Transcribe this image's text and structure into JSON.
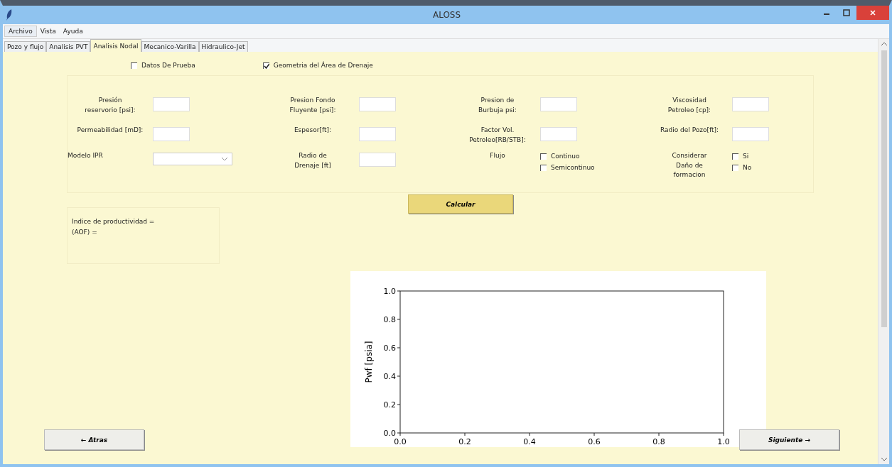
{
  "window": {
    "title": "ALOSS"
  },
  "menu": [
    {
      "label": "Archivo",
      "selected": true
    },
    {
      "label": "Vista",
      "selected": false
    },
    {
      "label": "Ayuda",
      "selected": false
    }
  ],
  "tabs": [
    {
      "label": "Pozo y flujo",
      "selected": false
    },
    {
      "label": "Analisis PVT",
      "selected": false
    },
    {
      "label": "Analisis Nodal",
      "selected": true
    },
    {
      "label": "Mecanico-Varilla",
      "selected": false
    },
    {
      "label": "Hidraulico-Jet",
      "selected": false
    }
  ],
  "options": [
    {
      "label": "Datos De Prueba",
      "checked": false
    },
    {
      "label": "Geometria del Área de Drenaje",
      "checked": true
    }
  ],
  "form": [
    {
      "kind": "input",
      "label": "Presión\nreservorio [psi]:"
    },
    {
      "kind": "input",
      "label": "Presion Fondo\nFluyente [psi]:"
    },
    {
      "kind": "input",
      "label": "Presion de\nBurbuja psi:"
    },
    {
      "kind": "input",
      "label": "Viscosidad\nPetroleo [cp]:"
    },
    {
      "kind": "input",
      "label": "Permeabilidad [mD]:"
    },
    {
      "kind": "input",
      "label": "Espesor[ft]:"
    },
    {
      "kind": "input",
      "label": "Factor Vol.\nPetroleo[RB/STB]:"
    },
    {
      "kind": "input",
      "label": "Radio del Pozo[ft]:"
    },
    {
      "kind": "select",
      "label": "Modelo IPR"
    },
    {
      "kind": "input",
      "label": "Radio de\nDrenaje [ft]"
    },
    {
      "kind": "checks",
      "label": "Flujo",
      "checks": [
        {
          "label": "Continuo",
          "checked": false
        },
        {
          "label": "Semicontinuo",
          "checked": false
        }
      ]
    },
    {
      "kind": "checks",
      "label": "Considerar\nDaño de\nformacion",
      "checks": [
        {
          "label": "Si",
          "checked": false
        },
        {
          "label": "No",
          "checked": false
        }
      ]
    }
  ],
  "calculate_button": "Calcular",
  "results": [
    "Indice de productividad =",
    "(AOF) ="
  ],
  "chart": {
    "chart_data": {
      "type": "line",
      "ylabel": "Pwf [psia]",
      "xlim": [
        0,
        1
      ],
      "ylim": [
        0,
        1
      ],
      "xticks": [
        {
          "value": 0,
          "label": "0.0"
        },
        {
          "value": 0.2,
          "label": "0.2"
        },
        {
          "value": 0.4,
          "label": "0.4"
        },
        {
          "value": 0.6,
          "label": "0.6"
        },
        {
          "value": 0.8,
          "label": "0.8"
        },
        {
          "value": 1,
          "label": "1.0"
        }
      ],
      "yticks": [
        {
          "value": 0,
          "label": "0.0"
        },
        {
          "value": 0.2,
          "label": "0.2"
        },
        {
          "value": 0.4,
          "label": "0.4"
        },
        {
          "value": 0.6,
          "label": "0.6"
        },
        {
          "value": 0.8,
          "label": "0.8"
        },
        {
          "value": 1,
          "label": "1.0"
        }
      ]
    }
  },
  "back_button": "← Atras",
  "next_button": "Siguiente →"
}
